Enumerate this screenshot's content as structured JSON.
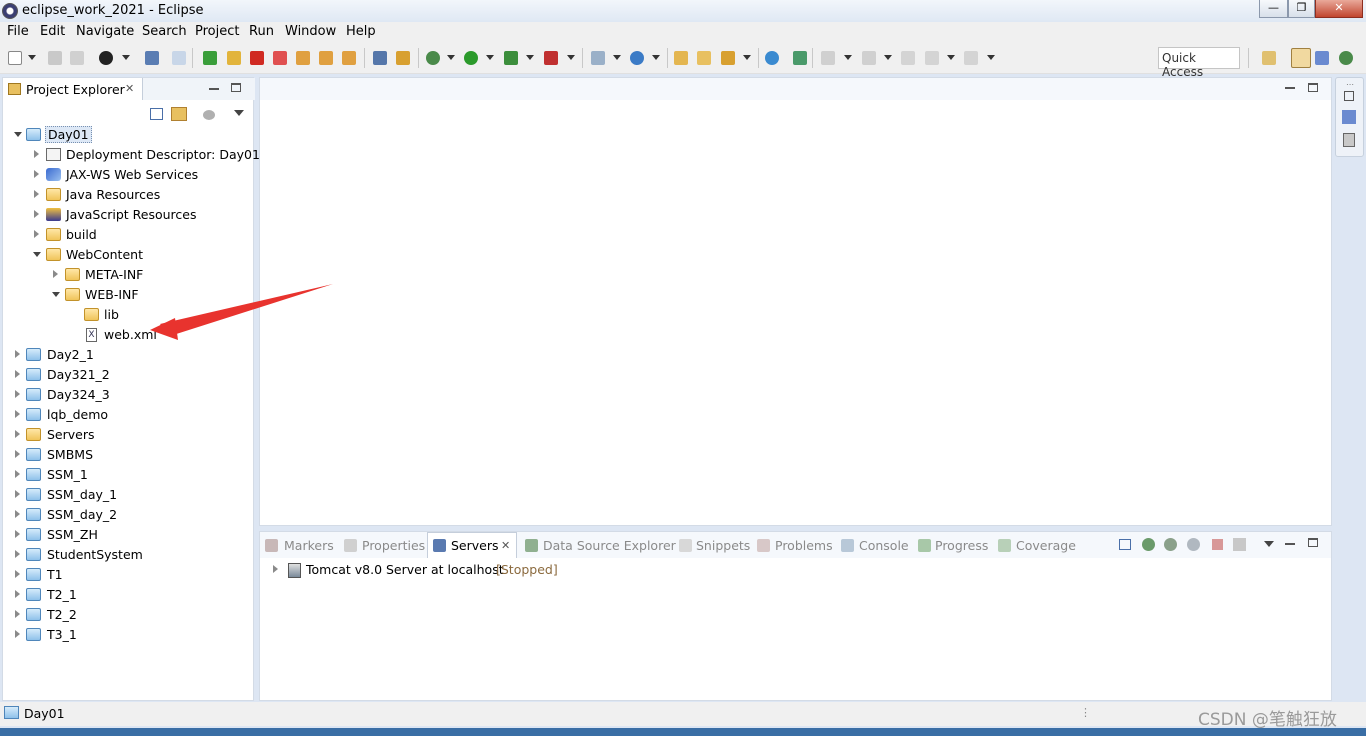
{
  "window": {
    "title": "eclipse_work_2021 - Eclipse",
    "minimize": "—",
    "maximize": "❐",
    "close": "✕"
  },
  "menu": [
    "File",
    "Edit",
    "Navigate",
    "Search",
    "Project",
    "Run",
    "Window",
    "Help"
  ],
  "toolbar": {
    "quick_access_placeholder": "Quick Access"
  },
  "project_explorer": {
    "tab_label": "Project Explorer",
    "tree": [
      {
        "label": "Day01",
        "icon": "project-folder-icon",
        "selected": true
      },
      {
        "label": "Deployment Descriptor: Day01",
        "icon": "deployment-descriptor-icon"
      },
      {
        "label": "JAX-WS Web Services",
        "icon": "webservices-icon"
      },
      {
        "label": "Java Resources",
        "icon": "java-resources-icon"
      },
      {
        "label": "JavaScript Resources",
        "icon": "javascript-resources-icon"
      },
      {
        "label": "build",
        "icon": "folder-icon"
      },
      {
        "label": "WebContent",
        "icon": "folder-icon"
      },
      {
        "label": "META-INF",
        "icon": "folder-icon"
      },
      {
        "label": "WEB-INF",
        "icon": "folder-icon"
      },
      {
        "label": "lib",
        "icon": "folder-icon"
      },
      {
        "label": "web.xml",
        "icon": "xml-file-icon"
      },
      {
        "label": "Day2_1",
        "icon": "project-folder-icon"
      },
      {
        "label": "Day321_2",
        "icon": "project-folder-icon"
      },
      {
        "label": "Day324_3",
        "icon": "project-folder-icon"
      },
      {
        "label": "lqb_demo",
        "icon": "project-folder-icon"
      },
      {
        "label": "Servers",
        "icon": "folder-icon"
      },
      {
        "label": "SMBMS",
        "icon": "project-folder-icon"
      },
      {
        "label": "SSM_1",
        "icon": "project-folder-icon"
      },
      {
        "label": "SSM_day_1",
        "icon": "project-folder-icon"
      },
      {
        "label": "SSM_day_2",
        "icon": "project-folder-icon"
      },
      {
        "label": "SSM_ZH",
        "icon": "project-folder-icon"
      },
      {
        "label": "StudentSystem",
        "icon": "project-folder-icon"
      },
      {
        "label": "T1",
        "icon": "project-folder-icon"
      },
      {
        "label": "T2_1",
        "icon": "project-folder-icon"
      },
      {
        "label": "T2_2",
        "icon": "project-folder-icon"
      },
      {
        "label": "T3_1",
        "icon": "project-folder-icon"
      }
    ]
  },
  "bottom_tabs": [
    "Markers",
    "Properties",
    "Servers",
    "Data Source Explorer",
    "Snippets",
    "Problems",
    "Console",
    "Progress",
    "Coverage"
  ],
  "servers": {
    "name": "Tomcat v8.0 Server at localhost",
    "state": "[Stopped]"
  },
  "status_bar": {
    "selection": "Day01"
  },
  "watermark": "CSDN @笔触狂放",
  "colors": {
    "accent": "#3a6ea5",
    "stopped": "#8b6a3e",
    "annotation_arrow": "#e8332e"
  }
}
